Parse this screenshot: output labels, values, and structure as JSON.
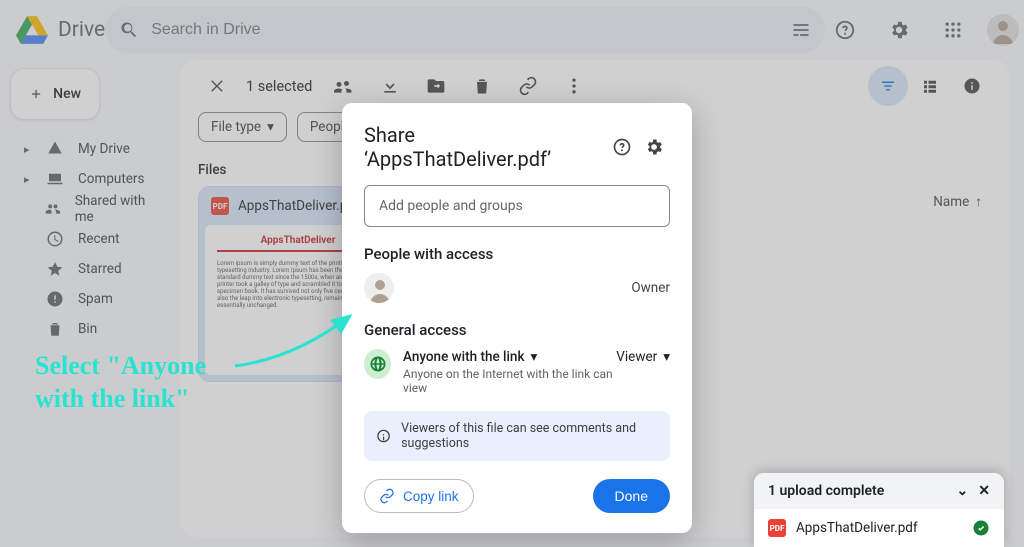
{
  "app": {
    "name": "Drive"
  },
  "search": {
    "placeholder": "Search in Drive"
  },
  "new_button": "New",
  "sidebar": {
    "items": [
      {
        "label": "My Drive"
      },
      {
        "label": "Computers"
      },
      {
        "label": "Shared with me"
      },
      {
        "label": "Recent"
      },
      {
        "label": "Starred"
      },
      {
        "label": "Spam"
      },
      {
        "label": "Bin"
      }
    ]
  },
  "toolbar": {
    "selected": "1 selected"
  },
  "chips": {
    "file_type": "File type",
    "people": "People"
  },
  "files": {
    "heading": "Files",
    "sort_label": "Name",
    "card": {
      "name": "AppsThatDeliver.pdf",
      "thumb_title": "AppsThatDeliver"
    }
  },
  "dialog": {
    "title": "Share ‘AppsThatDeliver.pdf’",
    "add_placeholder": "Add people and groups",
    "people_heading": "People with access",
    "owner_role": "Owner",
    "general_heading": "General access",
    "ga_label": "Anyone with the link",
    "ga_sub": "Anyone on the Internet with the link can view",
    "ga_role": "Viewer",
    "banner": "Viewers of this file can see comments and suggestions",
    "copy": "Copy link",
    "done": "Done"
  },
  "annotation": {
    "line1": "Select \"Anyone",
    "line2": "with the link\""
  },
  "toast": {
    "title": "1 upload complete",
    "file": "AppsThatDeliver.pdf"
  }
}
